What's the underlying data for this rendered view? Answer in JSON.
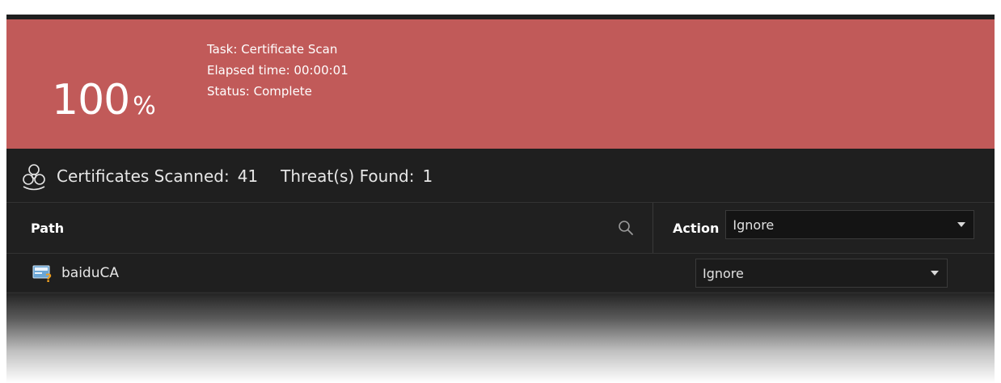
{
  "banner": {
    "percent_value": "100",
    "percent_symbol": "%",
    "task_line": "Task: Certificate Scan",
    "elapsed_line": "Elapsed time: 00:00:01",
    "status_line": "Status: Complete",
    "color": "#c15a59"
  },
  "summary": {
    "icon": "biohazard-icon",
    "scanned_label": "Certificates Scanned:",
    "scanned_count": "41",
    "threats_label": "Threat(s) Found:",
    "threats_count": "1"
  },
  "table": {
    "columns": {
      "path": "Path",
      "action": "Action"
    },
    "header_action_value": "Ignore",
    "rows": [
      {
        "name": "baiduCA",
        "icon": "certificate-warning-icon",
        "action": "Ignore"
      }
    ]
  }
}
